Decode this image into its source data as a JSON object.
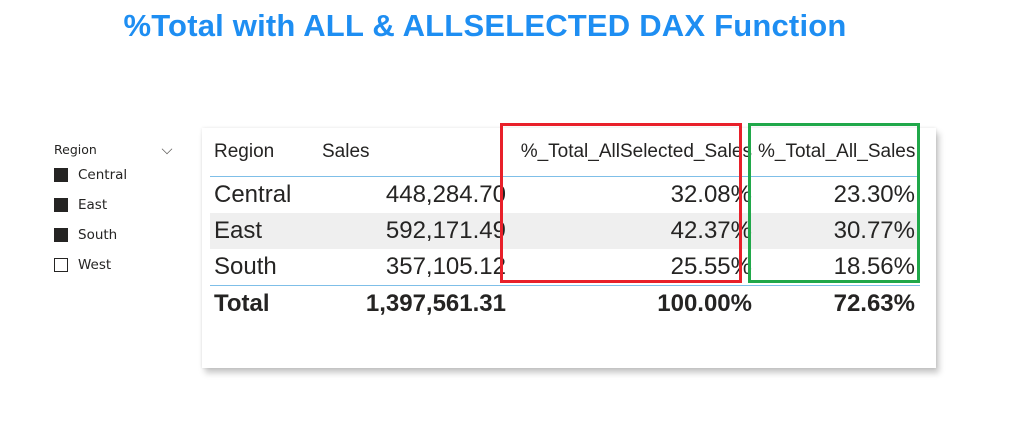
{
  "title": "%Total with ALL & ALLSELECTED DAX Function",
  "slicer": {
    "title": "Region",
    "items": [
      {
        "label": "Central",
        "checked": true
      },
      {
        "label": "East",
        "checked": true
      },
      {
        "label": "South",
        "checked": true
      },
      {
        "label": "West",
        "checked": false
      }
    ]
  },
  "table": {
    "headers": [
      "Region",
      "Sales",
      "%_Total_AllSelected_Sales",
      "%_Total_All_Sales"
    ],
    "rows": [
      [
        "Central",
        "448,284.70",
        "32.08%",
        "23.30%"
      ],
      [
        "East",
        "592,171.49",
        "42.37%",
        "30.77%"
      ],
      [
        "South",
        "357,105.12",
        "25.55%",
        "18.56%"
      ]
    ],
    "total": [
      "Total",
      "1,397,561.31",
      "100.00%",
      "72.63%"
    ]
  },
  "highlight_colors": {
    "allselected": "#e8202a",
    "all": "#20a84a"
  },
  "accent": "#1e8ef2"
}
